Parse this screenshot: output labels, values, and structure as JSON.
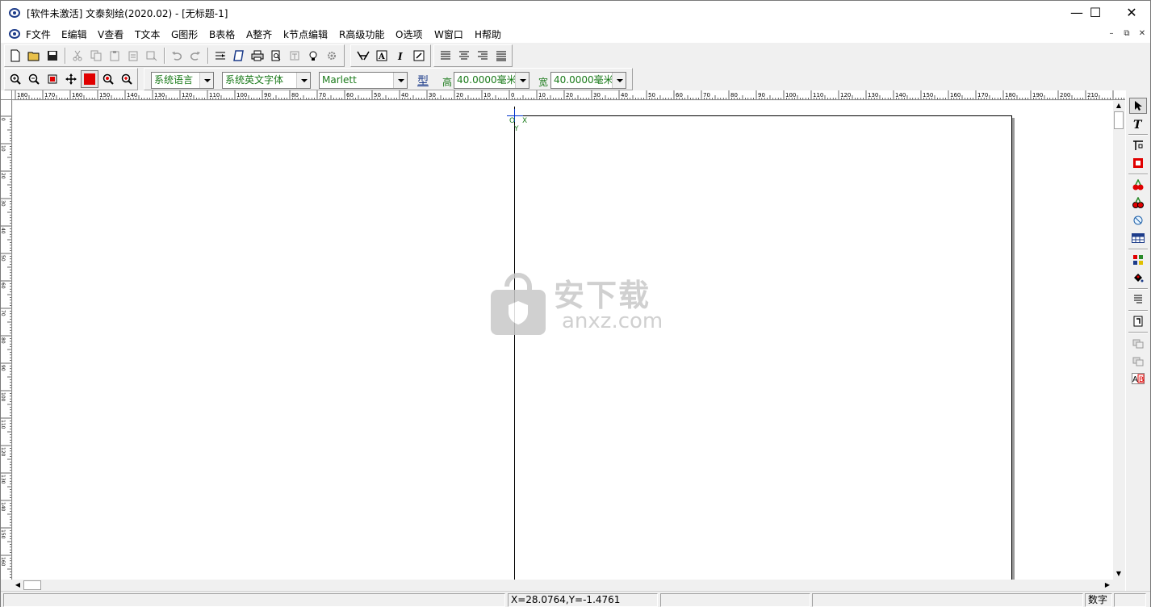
{
  "window": {
    "title": "[软件未激活] 文泰刻绘(2020.02) - [无标题-1]",
    "minimize": "—",
    "maximize": "☐",
    "close": "✕"
  },
  "menu": {
    "items": [
      "F文件",
      "E编辑",
      "V查看",
      "T文本",
      "G图形",
      "B表格",
      "A整齐",
      "k节点编辑",
      "R高级功能",
      "O选项",
      "W窗口",
      "H帮助"
    ],
    "mdi_min": "–",
    "mdi_restore": "⧉",
    "mdi_close": "✕"
  },
  "toolbar_text": {
    "language": "系统语言",
    "en_font": "系统英文字体",
    "font": "Marlett",
    "style_button": "型",
    "height_label": "高",
    "height_value": "40.0000毫米",
    "width_label": "宽",
    "width_value": "40.0000毫米"
  },
  "ruler": {
    "h_labels": [
      "180",
      "170",
      "160",
      "150",
      "140",
      "130",
      "120",
      "110",
      "100",
      "90",
      "80",
      "70",
      "60",
      "50",
      "40",
      "30",
      "20",
      "10",
      "0",
      "10",
      "20",
      "30",
      "40",
      "50",
      "60",
      "70",
      "80",
      "90",
      "100",
      "110",
      "120",
      "130",
      "140",
      "150",
      "160",
      "170",
      "180",
      "190",
      "200",
      "210"
    ],
    "v_labels": [
      "0",
      "10",
      "20",
      "30",
      "40",
      "50",
      "60",
      "70",
      "80",
      "90",
      "100",
      "110",
      "120",
      "130",
      "140",
      "150",
      "160",
      "170"
    ]
  },
  "canvas": {
    "origin_o": "O",
    "origin_x": "X",
    "origin_y": "Y",
    "watermark_cn": "安下载",
    "watermark_en": "anxz.com"
  },
  "status": {
    "coords": "X=28.0764,Y=-1.4761",
    "mode": "数字"
  },
  "colors": {
    "accent_green": "#1a7a1a",
    "selection_red": "#e00000"
  }
}
